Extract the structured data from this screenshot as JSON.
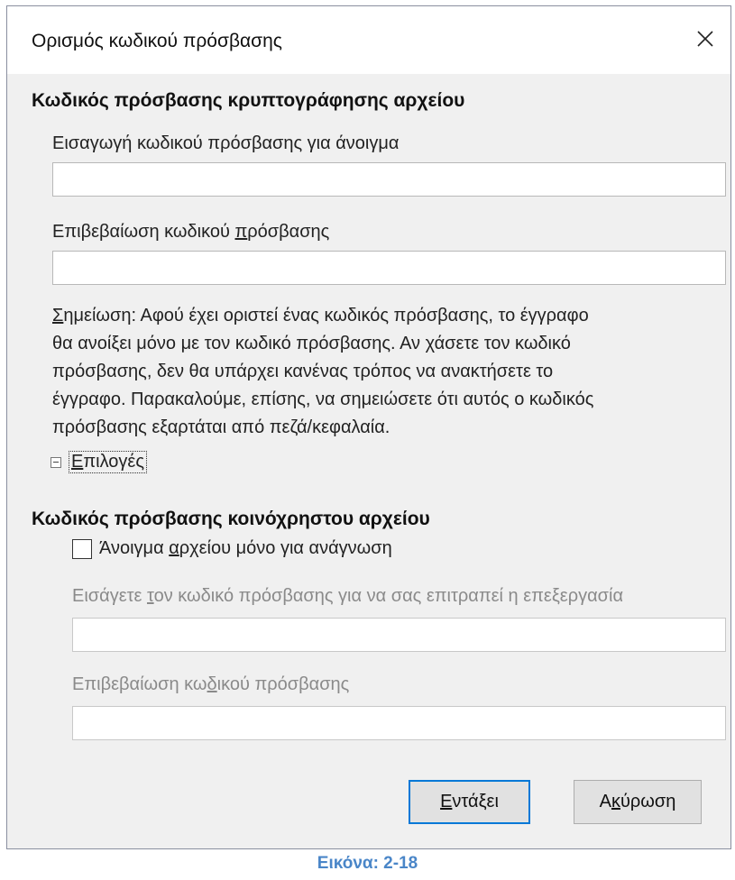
{
  "window": {
    "title": "Ορισμός κωδικού πρόσβασης",
    "close_icon": "close-icon"
  },
  "encryption": {
    "heading": "Κωδικός πρόσβασης κρυπτογράφησης αρχείου",
    "open_password_label": "Εισαγωγή κωδικού πρόσβασης για άνοιγμα",
    "open_password_value": "",
    "confirm_label_pre": "Επιβεβαίωση κωδικού ",
    "confirm_label_mnemonic": "π",
    "confirm_label_post": "ρόσβασης",
    "confirm_value": ""
  },
  "note": {
    "mnemonic": "Σ",
    "lines": [
      "ημείωση: Αφού έχει οριστεί ένας κωδικός πρόσβασης, το έγγραφο",
      "θα ανοίξει μόνο με τον κωδικό πρόσβασης. Αν χάσετε τον κωδικό",
      "πρόσβασης, δεν θα υπάρχει κανένας τρόπος να ανακτήσετε το",
      "έγγραφο. Παρακαλούμε, επίσης, να σημειώσετε ότι αυτός ο κωδικός",
      "πρόσβασης εξαρτάται από πεζά/κεφαλαία."
    ]
  },
  "options": {
    "mnemonic": "Ε",
    "label_rest": "πιλογές",
    "expanded": true
  },
  "sharing": {
    "heading": "Κωδικός πρόσβασης κοινόχρηστου αρχείου",
    "readonly_pre": "Άνοιγμα ",
    "readonly_mnemonic": "α",
    "readonly_post": "ρχείου μόνο για ανάγνωση",
    "readonly_checked": false,
    "edit_label_pre": "Εισάγετε ",
    "edit_label_mnemonic": "τ",
    "edit_label_post": "ον κωδικό πρόσβασης για να σας επιτραπεί η επεξεργασία",
    "edit_value": "",
    "confirm_label_pre": "Επιβεβαίωση κω",
    "confirm_label_mnemonic": "δ",
    "confirm_label_post": "ικού πρόσβασης",
    "confirm_value": ""
  },
  "buttons": {
    "ok_mnemonic": "Ε",
    "ok_rest": "ντάξει",
    "cancel_pre": "Α",
    "cancel_mnemonic": "κ",
    "cancel_post": "ύρωση"
  },
  "caption": "Εικόνα: 2-18"
}
